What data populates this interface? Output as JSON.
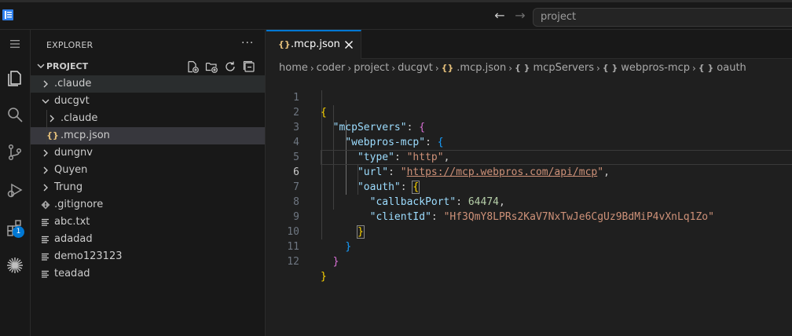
{
  "titlebar": {
    "search_placeholder": "project"
  },
  "activity": {
    "extensions_badge": "1"
  },
  "sidebar": {
    "title": "EXPLORER",
    "more": "···",
    "section_label": "PROJECT",
    "items": [
      {
        "label": ".claude",
        "type": "folder",
        "expanded": false,
        "depth": 0
      },
      {
        "label": "ducgvt",
        "type": "folder",
        "expanded": true,
        "depth": 0
      },
      {
        "label": ".claude",
        "type": "folder",
        "expanded": false,
        "depth": 1
      },
      {
        "label": ".mcp.json",
        "type": "json",
        "depth": 1,
        "icon": "{}"
      },
      {
        "label": "dungnv",
        "type": "folder",
        "expanded": false,
        "depth": 0
      },
      {
        "label": "Quyen",
        "type": "folder",
        "expanded": false,
        "depth": 0
      },
      {
        "label": "Trung",
        "type": "folder",
        "expanded": false,
        "depth": 0
      },
      {
        "label": ".gitignore",
        "type": "git",
        "depth": 0
      },
      {
        "label": "abc.txt",
        "type": "text",
        "depth": 0
      },
      {
        "label": "adadad",
        "type": "text",
        "depth": 0
      },
      {
        "label": "demo123123",
        "type": "text",
        "depth": 0
      },
      {
        "label": "teadad",
        "type": "text",
        "depth": 0
      }
    ]
  },
  "editor": {
    "tab": {
      "icon": "{}",
      "label": ".mcp.json"
    },
    "breadcrumb": [
      {
        "label": "home"
      },
      {
        "label": "coder"
      },
      {
        "label": "project"
      },
      {
        "label": "ducgvt"
      },
      {
        "label": ".mcp.json",
        "icon": "{}"
      },
      {
        "label": "mcpServers",
        "icon": "{ }"
      },
      {
        "label": "webpros-mcp",
        "icon": "{ }"
      },
      {
        "label": "oauth",
        "icon": "{ }"
      }
    ],
    "line_numbers": [
      "1",
      "2",
      "3",
      "4",
      "5",
      "6",
      "7",
      "8",
      "9",
      "10",
      "11",
      "12"
    ],
    "code": {
      "open_brace": "{",
      "key_mcpServers": "\"mcpServers\"",
      "key_webpros": "\"webpros-mcp\"",
      "key_type": "\"type\"",
      "val_type": "\"http\"",
      "key_url": "\"url\"",
      "val_url_q1": "\"",
      "val_url_link": "https://mcp.webpros.com/api/mcp",
      "val_url_q2": "\"",
      "key_oauth": "\"oauth\"",
      "key_callbackPort": "\"callbackPort\"",
      "val_callbackPort": "64474",
      "key_clientId": "\"clientId\"",
      "val_clientId": "\"Hf3QmY8LPRs2KaV7NxTwJe6CgUz9BdMiP4vXnLq1Zo\"",
      "colon": ":",
      "comma": ",",
      "close_brace": "}"
    }
  }
}
